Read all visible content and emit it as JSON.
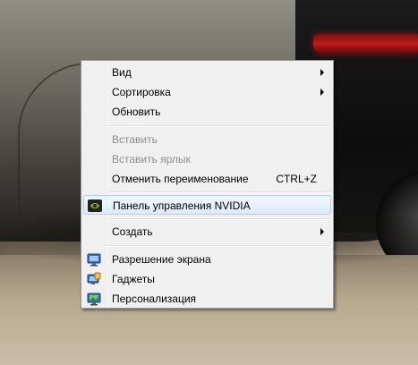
{
  "context_menu": {
    "items": {
      "view": {
        "label": "Вид"
      },
      "sort": {
        "label": "Сортировка"
      },
      "refresh": {
        "label": "Обновить"
      },
      "paste": {
        "label": "Вставить"
      },
      "paste_shortcut": {
        "label": "Вставить ярлык"
      },
      "undo_rename": {
        "label": "Отменить переименование",
        "shortcut": "CTRL+Z"
      },
      "nvidia": {
        "label": "Панель управления NVIDIA",
        "icon": "nvidia-icon"
      },
      "new": {
        "label": "Создать"
      },
      "screen_resolution": {
        "label": "Разрешение экрана",
        "icon": "monitor-icon"
      },
      "gadgets": {
        "label": "Гаджеты",
        "icon": "gadgets-icon"
      },
      "personalize": {
        "label": "Персонализация",
        "icon": "personalize-icon"
      }
    },
    "colors": {
      "background": "#f0f0f0",
      "highlight": "#dceafc",
      "disabled_text": "#8d8d8d"
    }
  }
}
